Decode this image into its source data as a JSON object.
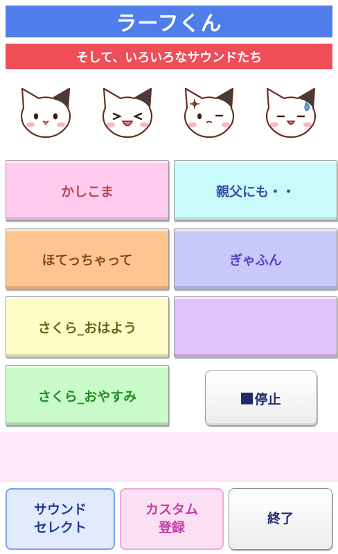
{
  "header": {
    "title": "ラーフくん",
    "subtitle": "そして、いろいろなサウンドたち"
  },
  "cats": [
    {
      "icon": "cat-smile-icon"
    },
    {
      "icon": "cat-squint-icon"
    },
    {
      "icon": "cat-sparkle-icon"
    },
    {
      "icon": "cat-sweat-icon"
    }
  ],
  "sounds": [
    {
      "label": "かしこま",
      "bg": "#ffcbee",
      "color": "#b8494c"
    },
    {
      "label": "親父にも・・",
      "bg": "#c9fbfb",
      "color": "#3b4aa4"
    },
    {
      "label": "ほてっちゃって",
      "bg": "#fec591",
      "color": "#8c4a1a"
    },
    {
      "label": "ぎゃふん",
      "bg": "#c8c8fb",
      "color": "#5b3fc2"
    },
    {
      "label": "さくら_おはよう",
      "bg": "#fefdc8",
      "color": "#6a6414"
    },
    {
      "label": "",
      "bg": "#e3c3fc",
      "color": "#5b3fc2"
    },
    {
      "label": "さくら_おやすみ",
      "bg": "#c9fbc9",
      "color": "#1f8c24"
    }
  ],
  "controls": {
    "stop_label": "停止"
  },
  "footer": {
    "sound_select_label": "サウンド\nセレクト",
    "custom_register_label": "カスタム\n登録",
    "exit_label": "終了"
  }
}
